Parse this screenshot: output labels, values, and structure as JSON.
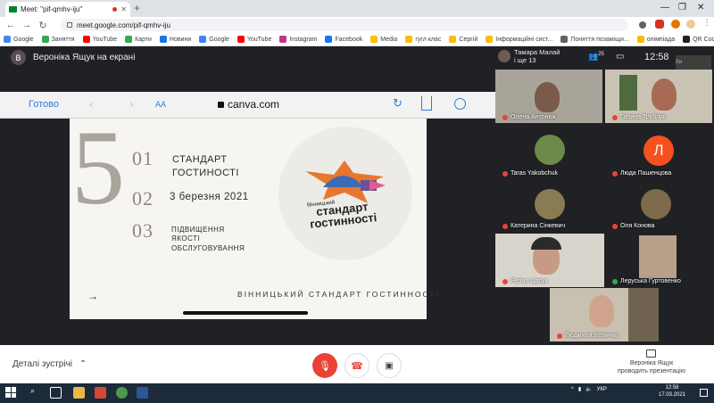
{
  "browser": {
    "tab_title": "Meet: \"pif-qmhv-iju\"",
    "url": "meet.google.com/pif-qmhv-iju",
    "bookmarks": [
      {
        "label": "Google",
        "color": "#4285f4"
      },
      {
        "label": "Заняття",
        "color": "#34a853"
      },
      {
        "label": "YouTube",
        "color": "#ff0000"
      },
      {
        "label": "Карти",
        "color": "#34a853"
      },
      {
        "label": "Новини",
        "color": "#1a73e8"
      },
      {
        "label": "Google",
        "color": "#4285f4"
      },
      {
        "label": "YouTube",
        "color": "#ff0000"
      },
      {
        "label": "Instagram",
        "color": "#c13584"
      },
      {
        "label": "Facebook",
        "color": "#1877f2"
      },
      {
        "label": "Media",
        "color": "#fbbc04"
      },
      {
        "label": "гугл клас",
        "color": "#fbbc04"
      },
      {
        "label": "Сергій",
        "color": "#fbbc04"
      },
      {
        "label": "Інформаційні сист...",
        "color": "#fbbc04"
      },
      {
        "label": "Поняття позаміщи...",
        "color": "#5f6368"
      },
      {
        "label": "олімпіада",
        "color": "#fbbc04"
      },
      {
        "label": "QR Coder - Генера...",
        "color": "#202124"
      }
    ]
  },
  "meet": {
    "presenter_initial": "В",
    "presenter_banner": "Вероніка Ящук на екрані",
    "header_name_line1": "Тамара Малай",
    "header_name_line2": "і ще 13",
    "participant_count": "25",
    "time": "12:58",
    "self_label": "Ви",
    "participants": [
      {
        "name": "Олена Антонюк",
        "muted": true
      },
      {
        "name": "Галина Трубляк",
        "muted": true
      },
      {
        "name": "Taras Yakobchuk",
        "muted": true
      },
      {
        "name": "Люда Пашенцова",
        "muted": true,
        "initial": "Л"
      },
      {
        "name": "Катерина Сінкевич",
        "muted": true
      },
      {
        "name": "Оля Конова",
        "muted": true
      },
      {
        "name": "Регіна Царук",
        "muted": true
      },
      {
        "name": "Леруська Гуртовенко",
        "muted": false
      },
      {
        "name": "Людмила Величко",
        "muted": true
      }
    ],
    "meeting_details": "Деталі зустрічі",
    "presenting_line1": "Вероніка Ящук",
    "presenting_line2": "проводить презентацію"
  },
  "ios": {
    "done": "Готово",
    "aa": "AA",
    "domain": "canva.com"
  },
  "slide": {
    "big_number": "5",
    "items": [
      {
        "num": "01",
        "text": "СТАНДАРТ ГОСТИНОСТІ"
      },
      {
        "num": "02",
        "text": "3 березня 2021"
      },
      {
        "num": "03",
        "text": "ПІДВИЩЕННЯ ЯКОСТІ ОБСЛУГОВУВАННЯ"
      }
    ],
    "logo_small": "Вінницький",
    "logo_line1": "стандарт",
    "logo_line2": "гостинності",
    "footer": "ВІННИЦЬКИЙ СТАНДАРТ ГОСТИННОСТІ",
    "arrow": "→"
  },
  "taskbar": {
    "lang": "УКР",
    "time": "12:58",
    "date": "17.03.2021"
  },
  "colors": {
    "mute_red": "#ea4335",
    "accent_blue": "#2f7bd7",
    "avatar_orange": "#f4511e"
  }
}
